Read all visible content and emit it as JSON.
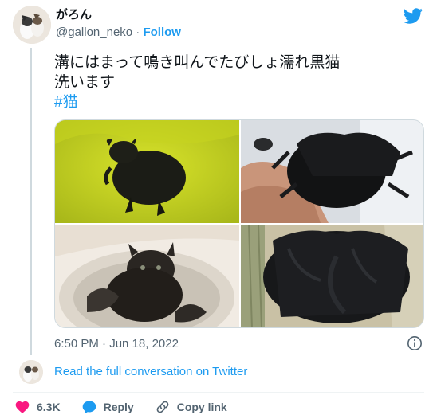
{
  "tweet": {
    "author_name": "がろん",
    "author_handle": "@gallon_neko",
    "separator": " · ",
    "follow_label": "Follow",
    "text_line1": "溝にはまって鳴き叫んでたびしょ濡れ黒猫",
    "text_line2": "洗います",
    "hashtag": "#猫",
    "timestamp": "6:50 PM · Jun 18, 2022",
    "read_conversation": "Read the full conversation on Twitter"
  },
  "actions": {
    "like_count": "6.3K",
    "reply_label": "Reply",
    "copy_link_label": "Copy link"
  },
  "colors": {
    "accent": "#1d9bf0",
    "like": "#f91880",
    "text_secondary": "#536471"
  },
  "icons": {
    "brand": "twitter-bird-icon",
    "info": "info-icon",
    "like": "heart-icon",
    "reply": "speech-bubble-icon",
    "link": "link-icon"
  }
}
